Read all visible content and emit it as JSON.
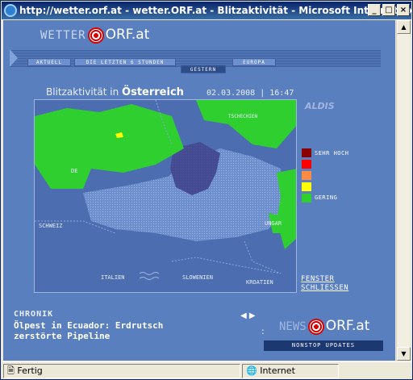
{
  "window": {
    "title": "http://wetter.orf.at - wetter.ORF.at - Blitzaktivität - Microsoft Internet Ex..."
  },
  "logo": {
    "prefix": "WETTER",
    "brand": "ORF.at"
  },
  "nav": {
    "tabs": [
      "AKTUELL",
      "DIE LETZTEN 6 STUNDEN",
      "EUROPA"
    ],
    "active_tab": "GESTERN"
  },
  "map": {
    "heading_prefix": "Blitzaktivität in",
    "heading_region": "Österreich",
    "date": "02.03.2008",
    "time": "16:47",
    "sponsor": "ALDIS",
    "labels": {
      "de": "DE",
      "schweiz": "SCHWEIZ",
      "italien": "ITALIEN",
      "slowenien": "SLOWENIEN",
      "kroatien": "KROATIEN",
      "ungarn": "UNGAR",
      "tschechien": "TSCHECHIEN"
    },
    "legend": {
      "high": "SEHR HOCH",
      "low": "GERING"
    },
    "legend_colors": [
      "#8b0000",
      "#ff0000",
      "#ff8c42",
      "#ffff00",
      "#2fcf2f"
    ]
  },
  "close_link": {
    "line1": "FENSTER",
    "line2": "SCHLIESSEN"
  },
  "chronik": {
    "label": "CHRONIK",
    "line1": "Ölpest in Ecuador: Erdrutsch",
    "line2": "zerstörte Pipeline"
  },
  "news": {
    "prefix": "NEWS",
    "brand": "ORF.at",
    "tagline": "NONSTOP UPDATES"
  },
  "status": {
    "left": "Fertig",
    "zone": "Internet"
  }
}
